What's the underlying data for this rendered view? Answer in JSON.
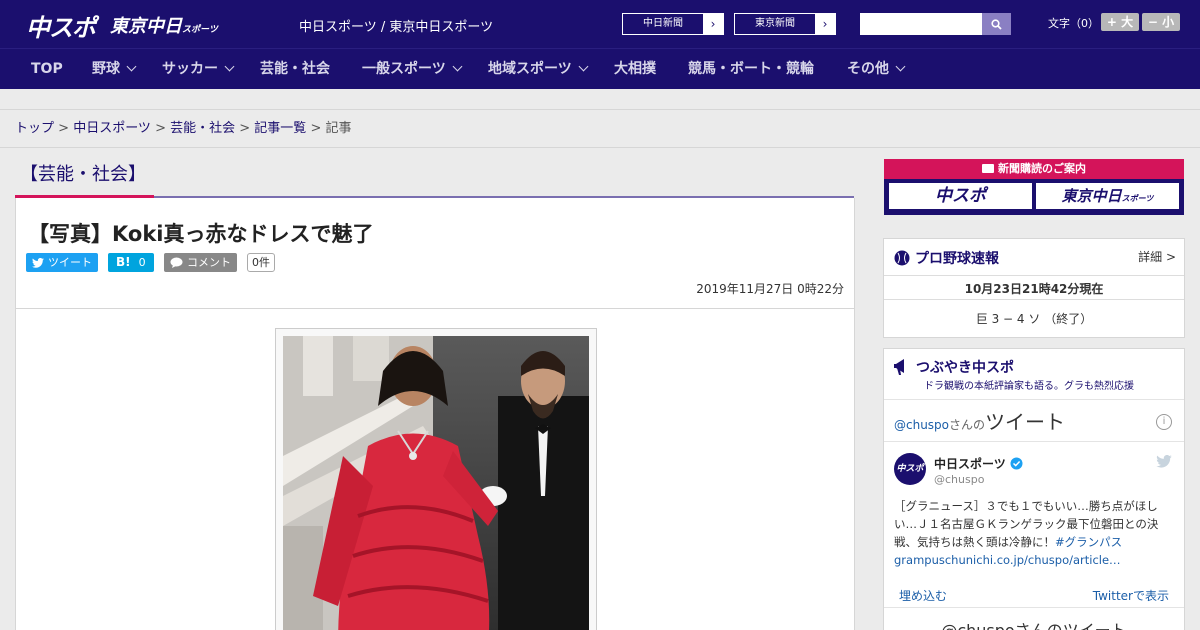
{
  "header": {
    "logo_chuspo": "中スポ",
    "logo_tokyo": "東京中日",
    "logo_tokyo_small": "スポーツ",
    "site_names": "中日スポーツ / 東京中日スポーツ",
    "paper1": "中日新聞",
    "paper2": "東京新聞",
    "search_placeholder": "",
    "font_label": "文字（0）",
    "font_plus": "+ 大",
    "font_minus": "− 小"
  },
  "nav": {
    "items": [
      {
        "label": "TOP",
        "dropdown": false
      },
      {
        "label": "野球",
        "dropdown": true
      },
      {
        "label": "サッカー",
        "dropdown": true
      },
      {
        "label": "芸能・社会",
        "dropdown": false
      },
      {
        "label": "一般スポーツ",
        "dropdown": true
      },
      {
        "label": "地域スポーツ",
        "dropdown": true
      },
      {
        "label": "大相撲",
        "dropdown": false
      },
      {
        "label": "競馬・ボート・競輪",
        "dropdown": false
      },
      {
        "label": "その他",
        "dropdown": true
      }
    ]
  },
  "breadcrumb": {
    "items": [
      "トップ",
      "中日スポーツ",
      "芸能・社会",
      "記事一覧"
    ],
    "current": "記事",
    "sep": " > "
  },
  "article": {
    "category": "【芸能・社会】",
    "title": "【写真】Koki真っ赤なドレスで魅了",
    "tweet_label": "ツイート",
    "hatena_label": "B!",
    "hatena_count": "0",
    "comment_label": "コメント",
    "comment_count": "0件",
    "date": "2019年11月27日 0時22分"
  },
  "sidebar": {
    "subscribe_head": "新聞購読のご案内",
    "sub_logo1": "中スポ",
    "sub_logo2": "東京中日",
    "sub_logo2_small": "スポーツ",
    "baseball": {
      "title": "プロ野球速報",
      "detail": "詳細 >",
      "datetime": "10月23日21時42分現在",
      "score": "巨 3 − 4 ソ （終了）"
    },
    "tsubuyaki": {
      "title": "つぶやき中スポ",
      "subtitle": "ドラ観戦の本紙評論家も語る。グラも熱烈応援",
      "handle_prefix": "@chuspo",
      "handle_suffix": "さんの",
      "tweets_word": "ツイート",
      "user_name": "中日スポーツ",
      "user_handle": "@chuspo",
      "tweet_text": "［グラニュース］３でも１でもいい…勝ち点がほしい…Ｊ１名古屋ＧＫランゲラック最下位磐田との決戦、気持ちは熱く頭は冷静に！",
      "hashtag": "#グランパス",
      "link": "grampuschunichi.co.jp/chuspo/article…",
      "embed": "埋め込む",
      "view_twitter": "Twitterで表示",
      "footer_title": "@chuspoさんのツイート"
    }
  },
  "colors": {
    "brand_navy": "#1b0f6e",
    "accent_red": "#d4145a",
    "twitter_blue": "#1da1f2",
    "hatena_blue": "#00a4de",
    "comment_grey": "#888888"
  }
}
